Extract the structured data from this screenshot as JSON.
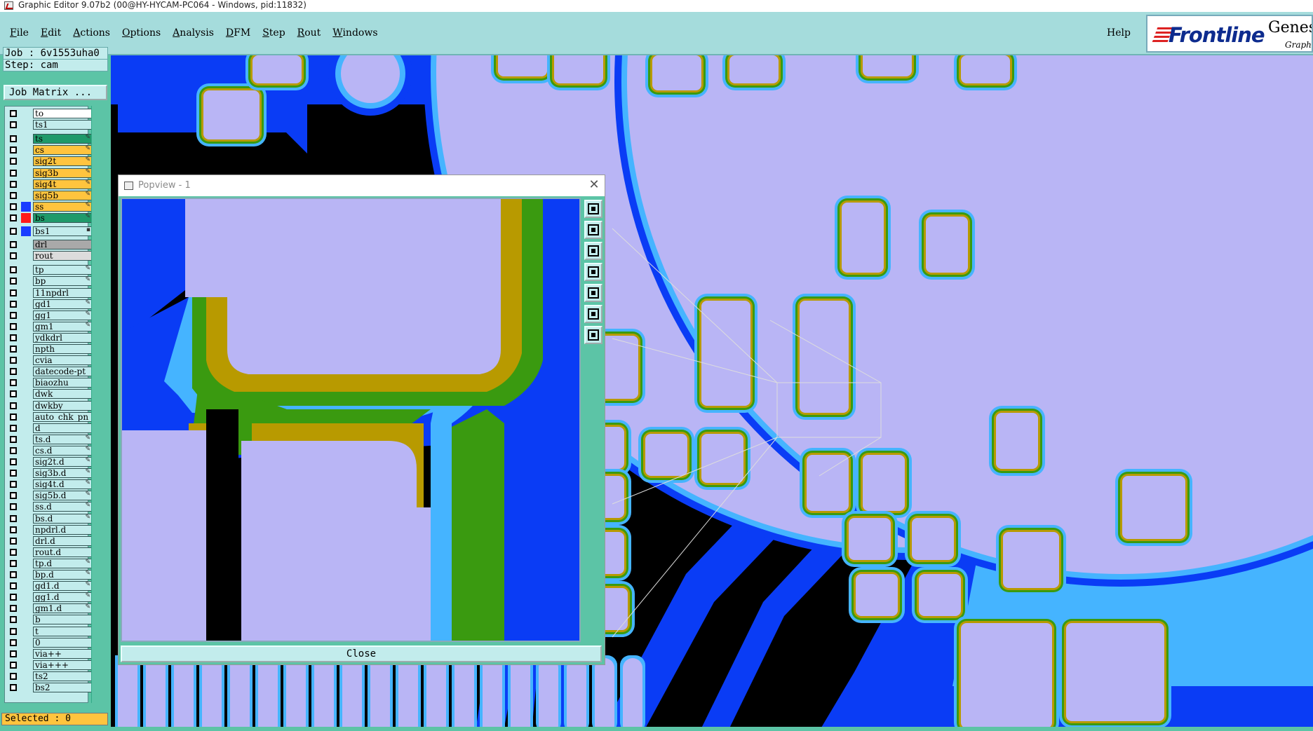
{
  "window": {
    "title": "Graphic Editor 9.07b2 (00@HY-HYCAM-PC064 - Windows, pid:11832)"
  },
  "menu": {
    "items": [
      "File",
      "Edit",
      "Actions",
      "Options",
      "Analysis",
      "DFM",
      "Step",
      "Rout",
      "Windows"
    ],
    "help": "Help"
  },
  "brand": {
    "name": "Frontline",
    "product": "Genesis",
    "subtitle": "Graphic"
  },
  "panel": {
    "job": "Job : 6v1553uha0",
    "step": "Step: cam",
    "job_matrix": "Job Matrix ...",
    "selected": "Selected : 0"
  },
  "layers": [
    {
      "name": "to",
      "bg": "#ffffff",
      "color": "",
      "mark": ""
    },
    {
      "name": "ts1",
      "bg": "#c2ecec",
      "color": "",
      "mark": ""
    },
    {
      "name": "ts",
      "bg": "#1f9a6a",
      "color": "",
      "mark": "✎"
    },
    {
      "name": "cs",
      "bg": "#ffc43e",
      "color": "",
      "mark": "✎"
    },
    {
      "name": "sig2t",
      "bg": "#ffc43e",
      "color": "",
      "mark": "✎"
    },
    {
      "name": "sig3b",
      "bg": "#ffc43e",
      "color": "",
      "mark": "✎"
    },
    {
      "name": "sig4t",
      "bg": "#ffc43e",
      "color": "",
      "mark": "✎"
    },
    {
      "name": "sig5b",
      "bg": "#ffc43e",
      "color": "",
      "mark": "✎"
    },
    {
      "name": "ss",
      "bg": "#ffc43e",
      "color": "#1a3cff",
      "mark": "✎"
    },
    {
      "name": "bs",
      "bg": "#1f9a6a",
      "color": "#ff1a1a",
      "mark": "✎"
    },
    {
      "name": "bs1",
      "bg": "#c2ecec",
      "color": "#1a3cff",
      "mark": "▪"
    },
    {
      "name": "drl",
      "bg": "#a9a9a9",
      "color": "",
      "mark": ""
    },
    {
      "name": "rout",
      "bg": "#dcdcdc",
      "color": "",
      "mark": ""
    },
    {
      "name": "tp",
      "bg": "#c2ecec",
      "color": "",
      "mark": "✎"
    },
    {
      "name": "bp",
      "bg": "#c2ecec",
      "color": "",
      "mark": "✎"
    },
    {
      "name": "11npdrl",
      "bg": "#c2ecec",
      "color": "",
      "mark": ""
    },
    {
      "name": "gd1",
      "bg": "#c2ecec",
      "color": "",
      "mark": "✎"
    },
    {
      "name": "gg1",
      "bg": "#c2ecec",
      "color": "",
      "mark": "✎"
    },
    {
      "name": "gm1",
      "bg": "#c2ecec",
      "color": "",
      "mark": "✎"
    },
    {
      "name": "ydkdrl",
      "bg": "#c2ecec",
      "color": "",
      "mark": ""
    },
    {
      "name": "npth",
      "bg": "#c2ecec",
      "color": "",
      "mark": ""
    },
    {
      "name": "cvia",
      "bg": "#c2ecec",
      "color": "",
      "mark": ""
    },
    {
      "name": "datecode-pt",
      "bg": "#c2ecec",
      "color": "",
      "mark": ""
    },
    {
      "name": "biaozhu",
      "bg": "#c2ecec",
      "color": "",
      "mark": ""
    },
    {
      "name": "dwk",
      "bg": "#c2ecec",
      "color": "",
      "mark": ""
    },
    {
      "name": "dwkby",
      "bg": "#c2ecec",
      "color": "",
      "mark": ""
    },
    {
      "name": "auto_chk_pn",
      "bg": "#c2ecec",
      "color": "",
      "mark": ""
    },
    {
      "name": "d",
      "bg": "#c2ecec",
      "color": "",
      "mark": ""
    },
    {
      "name": "ts.d",
      "bg": "#c2ecec",
      "color": "",
      "mark": "✎"
    },
    {
      "name": "cs.d",
      "bg": "#c2ecec",
      "color": "",
      "mark": "✎"
    },
    {
      "name": "sig2t.d",
      "bg": "#c2ecec",
      "color": "",
      "mark": "✎"
    },
    {
      "name": "sig3b.d",
      "bg": "#c2ecec",
      "color": "",
      "mark": "✎"
    },
    {
      "name": "sig4t.d",
      "bg": "#c2ecec",
      "color": "",
      "mark": "✎"
    },
    {
      "name": "sig5b.d",
      "bg": "#c2ecec",
      "color": "",
      "mark": "✎"
    },
    {
      "name": "ss.d",
      "bg": "#c2ecec",
      "color": "",
      "mark": "✎"
    },
    {
      "name": "bs.d",
      "bg": "#c2ecec",
      "color": "",
      "mark": "✎"
    },
    {
      "name": "npdrl.d",
      "bg": "#c2ecec",
      "color": "",
      "mark": ""
    },
    {
      "name": "drl.d",
      "bg": "#c2ecec",
      "color": "",
      "mark": ""
    },
    {
      "name": "rout.d",
      "bg": "#c2ecec",
      "color": "",
      "mark": ""
    },
    {
      "name": "tp.d",
      "bg": "#c2ecec",
      "color": "",
      "mark": "✎"
    },
    {
      "name": "bp.d",
      "bg": "#c2ecec",
      "color": "",
      "mark": "✎"
    },
    {
      "name": "gd1.d",
      "bg": "#c2ecec",
      "color": "",
      "mark": "✎"
    },
    {
      "name": "gg1.d",
      "bg": "#c2ecec",
      "color": "",
      "mark": "✎"
    },
    {
      "name": "gm1.d",
      "bg": "#c2ecec",
      "color": "",
      "mark": "✎"
    },
    {
      "name": "b",
      "bg": "#c2ecec",
      "color": "",
      "mark": ""
    },
    {
      "name": "t",
      "bg": "#c2ecec",
      "color": "",
      "mark": ""
    },
    {
      "name": "0",
      "bg": "#c2ecec",
      "color": "",
      "mark": ""
    },
    {
      "name": "via++",
      "bg": "#c2ecec",
      "color": "",
      "mark": ""
    },
    {
      "name": "via+++",
      "bg": "#c2ecec",
      "color": "",
      "mark": ""
    },
    {
      "name": "ts2",
      "bg": "#c2ecec",
      "color": "",
      "mark": ""
    },
    {
      "name": "bs2",
      "bg": "#c2ecec",
      "color": "",
      "mark": ""
    }
  ],
  "popview": {
    "title": "Popview - 1",
    "close_label": "Close",
    "tools": [
      "zoom-fit-icon",
      "pan-up-icon",
      "pan-down-icon",
      "pan-left-icon",
      "pan-right-icon",
      "zoom-out-icon",
      "zoom-in-icon"
    ]
  },
  "colors": {
    "copper_blue": "#0a3cf5",
    "mask_cyan": "#45b4ff",
    "pad_lavender": "#b9b5f5",
    "green": "#3a9a10",
    "olive": "#b89a00",
    "panel": "#5cc4a6",
    "field": "#c2ecec"
  }
}
